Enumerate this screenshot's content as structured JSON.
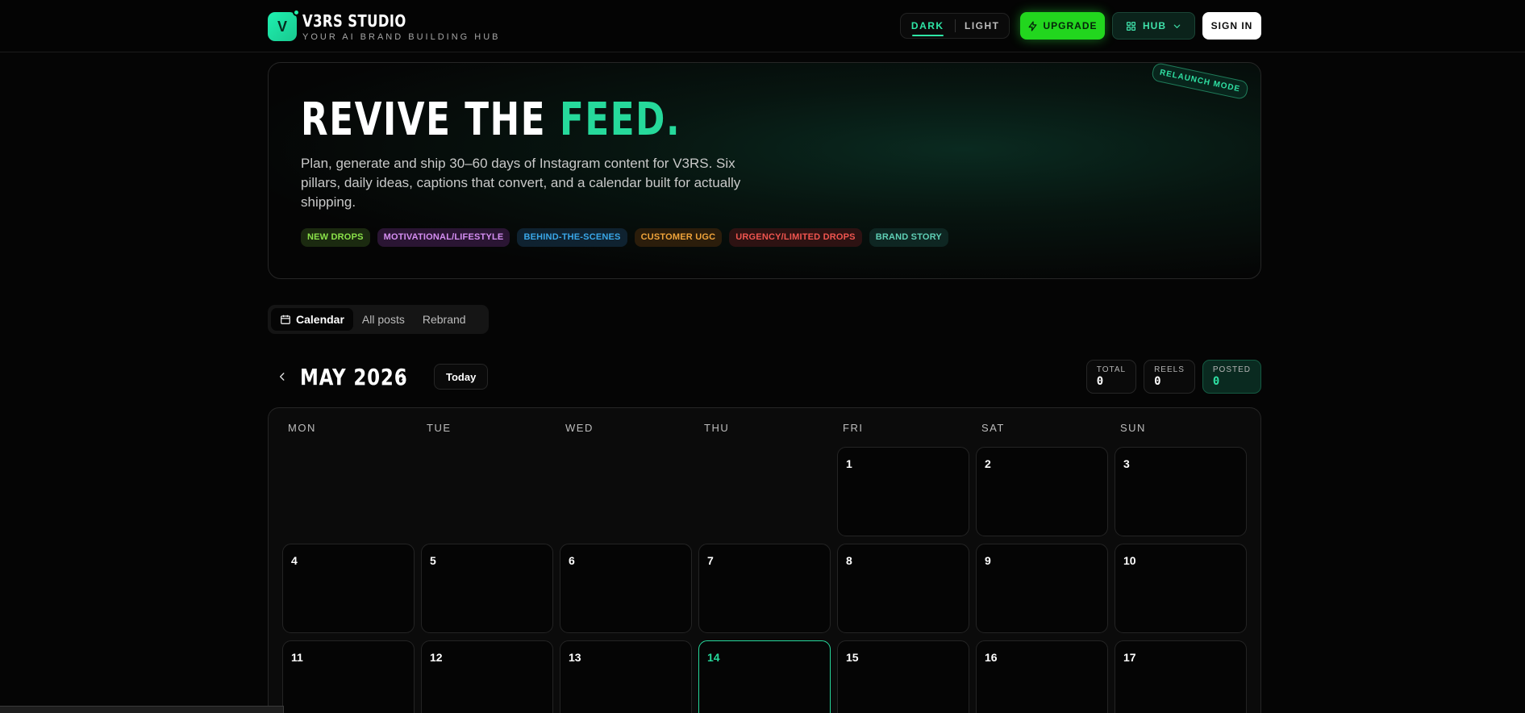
{
  "header": {
    "brand_name": "V3RS STUDIO",
    "brand_tagline": "YOUR AI BRAND BUILDING HUB",
    "logo_letter": "V",
    "theme_dark": "DARK",
    "theme_light": "LIGHT",
    "upgrade_label": "UPGRADE",
    "hub_label": "HUB",
    "signin_label": "SIGN IN"
  },
  "hero": {
    "title_main": "REVIVE THE ",
    "title_accent": "FEED.",
    "description": "Plan, generate and ship 30–60 days of Instagram content for V3RS. Six pillars, daily ideas, captions that convert, and a calendar built for actually shipping.",
    "badge": "RELAUNCH MODE",
    "pillars": [
      {
        "label": "NEW DROPS",
        "color": "#8be24a",
        "bg": "#1b2a10"
      },
      {
        "label": "MOTIVATIONAL/LIFESTYLE",
        "color": "#d58ef2",
        "bg": "#2a1533"
      },
      {
        "label": "BEHIND-THE-SCENES",
        "color": "#3aa7e8",
        "bg": "#0f2230"
      },
      {
        "label": "CUSTOMER UGC",
        "color": "#f0a43a",
        "bg": "#2b1d0b"
      },
      {
        "label": "URGENCY/LIMITED DROPS",
        "color": "#f0554f",
        "bg": "#2d1212"
      },
      {
        "label": "BRAND STORY",
        "color": "#5fcfb5",
        "bg": "#0e2622"
      }
    ]
  },
  "view_tabs": [
    {
      "label": "Calendar",
      "active": true
    },
    {
      "label": "All posts",
      "active": false
    },
    {
      "label": "Rebrand",
      "active": false
    }
  ],
  "month_nav": {
    "month": "MAY 2026",
    "today_label": "Today"
  },
  "stats": [
    {
      "label": "TOTAL",
      "value": "0"
    },
    {
      "label": "REELS",
      "value": "0"
    },
    {
      "label": "POSTED",
      "value": "0"
    }
  ],
  "calendar": {
    "weekdays": [
      "MON",
      "TUE",
      "WED",
      "THU",
      "FRI",
      "SAT",
      "SUN"
    ],
    "leading_blanks": 4,
    "visible_days": [
      "1",
      "2",
      "3",
      "4",
      "5",
      "6",
      "7",
      "8",
      "9",
      "10",
      "11",
      "12",
      "13",
      "14",
      "15",
      "16",
      "17"
    ],
    "today": "14"
  },
  "colors": {
    "accent": "#26d99b",
    "upgrade": "#22d61e"
  }
}
